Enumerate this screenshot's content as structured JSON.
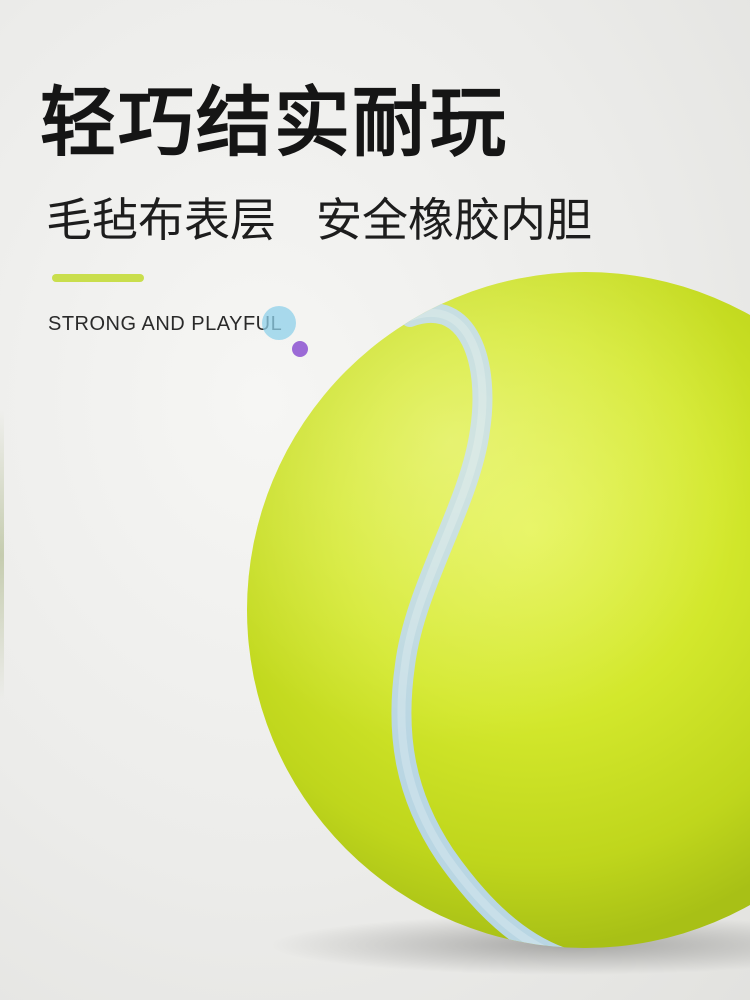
{
  "headline": "轻巧结实耐玩",
  "subline": {
    "part1": "毛毡布表层",
    "part2": "安全橡胶内胆"
  },
  "tagline": "STRONG AND PLAYFUL",
  "colors": {
    "accent_bar": "#c9de4c",
    "dot_blue": "#8fd0ea",
    "dot_purple": "#9b6ad6",
    "ball_felt": "#cfe62a",
    "ball_seam": "#b9d6e3"
  },
  "images": {
    "ball": "tennis-ball-photo"
  }
}
